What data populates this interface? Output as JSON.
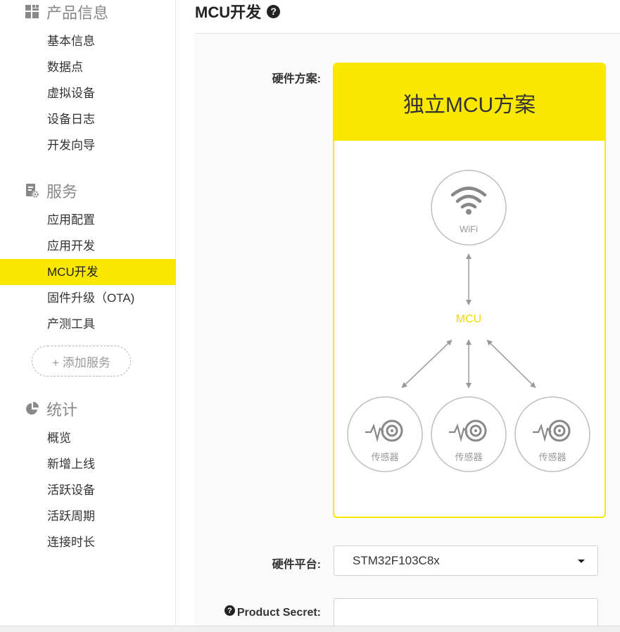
{
  "sidebar": {
    "sections": [
      {
        "title": "产品信息",
        "icon": "product-info-grid-icon",
        "items": [
          "基本信息",
          "数据点",
          "虚拟设备",
          "设备日志",
          "开发向导"
        ]
      },
      {
        "title": "服务",
        "icon": "service-gear-icon",
        "items": [
          "应用配置",
          "应用开发",
          "MCU开发",
          "固件升级（OTA)",
          "产测工具"
        ]
      },
      {
        "title": "统计",
        "icon": "stats-pie-icon",
        "items": [
          "概览",
          "新增上线",
          "活跃设备",
          "活跃周期",
          "连接时长"
        ]
      }
    ],
    "active_item": "MCU开发",
    "add_service_label": "+ 添加服务"
  },
  "main": {
    "title": "MCU开发",
    "hardware_scheme_label": "硬件方案:",
    "scheme_card": {
      "title": "独立MCU方案",
      "wifi_label": "WiFi",
      "mcu_label": "MCU",
      "sensor_label": "传感器"
    },
    "hardware_platform_label": "硬件平台:",
    "hardware_platform_value": "STM32F103C8x",
    "product_secret_label": "Product Secret:",
    "product_secret_value": ""
  },
  "colors": {
    "accent_yellow": "#fbe800",
    "diagram_gray": "#999999",
    "mcu_text": "#f0d800"
  }
}
